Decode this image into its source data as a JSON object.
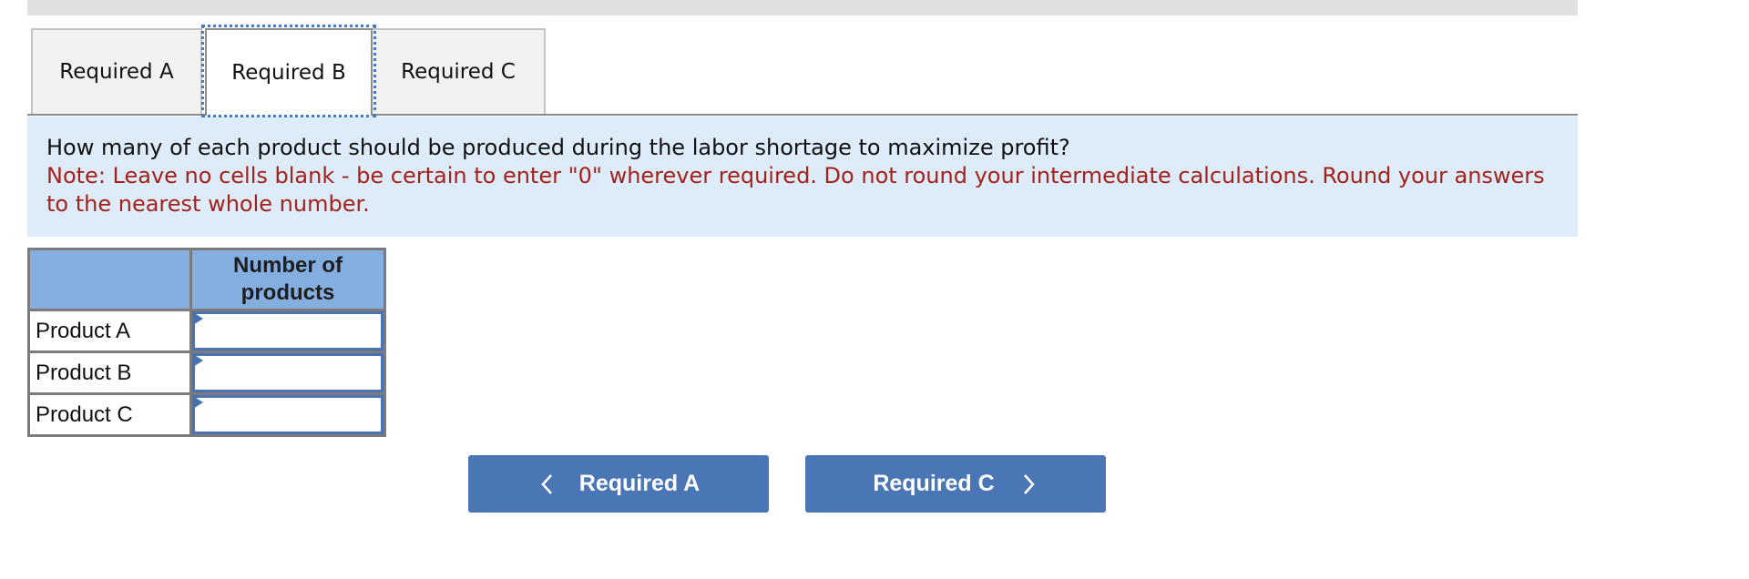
{
  "tabs": [
    {
      "label": "Required A",
      "active": false
    },
    {
      "label": "Required B",
      "active": true
    },
    {
      "label": "Required C",
      "active": false
    }
  ],
  "instructions": {
    "question": "How many of each product should be produced during the labor shortage to maximize profit?",
    "note": "Note: Leave no cells blank - be certain to enter \"0\" wherever required. Do not round your intermediate calculations. Round your answers to the nearest whole number."
  },
  "table": {
    "corner_header": "",
    "column_header": "Number of products",
    "rows": [
      {
        "label": "Product A",
        "value": ""
      },
      {
        "label": "Product B",
        "value": ""
      },
      {
        "label": "Product C",
        "value": ""
      }
    ]
  },
  "navigation": {
    "prev_label": "Required A",
    "prev_icon": "chevron-left-icon",
    "next_label": "Required C",
    "next_icon": "chevron-right-icon"
  },
  "colors": {
    "accent": "#4b76b5",
    "instruction_background": "#deebf8",
    "note_text": "#a4221c",
    "table_header": "#84ade0"
  }
}
